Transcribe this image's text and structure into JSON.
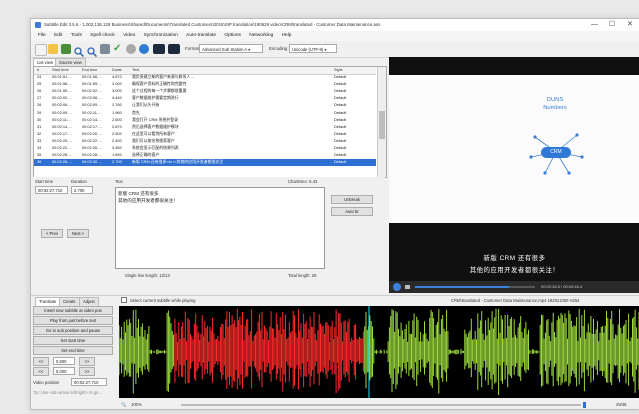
{
  "window": {
    "title": "Subtitle Edit 3.5.6 - 1.002.136.128 Business\\Shared\\Documents\\Translated Customers\\2016\\SIP translation\\180629 video\\CRM\\translated - Customer Data Maintenance.ass",
    "controls": [
      "—",
      "☐",
      "✕"
    ]
  },
  "menu": [
    "File",
    "Edit",
    "Tools",
    "Spell check",
    "Video",
    "Synchronization",
    "Auto-translate",
    "Options",
    "Networking",
    "Help"
  ],
  "toolbar": {
    "format_label": "Format",
    "format_value": "Advanced Sub Station A ▾",
    "encoding_label": "Encoding",
    "encoding_value": "Unicode (UTF-8) ▾",
    "icons": [
      "new-file-icon",
      "open-folder-icon",
      "save-icon",
      "find-icon",
      "replace-icon",
      "visual-sync-icon",
      "spell-check-icon",
      "settings-icon",
      "help-icon",
      "layout-icon",
      "video-icon"
    ]
  },
  "tabs": {
    "list_view": "List view",
    "source_view": "Source view"
  },
  "grid": {
    "headers": [
      "#",
      "Start time",
      "End time",
      "Durat.",
      "Text",
      "Style"
    ],
    "rows": [
      [
        "24",
        "00:01:51.…",
        "00:01:56.…",
        "4.870",
        "我负责建立新的客户来源与联系人…",
        "Default"
      ],
      [
        "25",
        "00:01:56.…",
        "00:01:59.…",
        "3.000",
        "确保客户资料的正确性和完整性",
        "Default"
      ],
      [
        "26",
        "00:01:59.…",
        "00:02:02.…",
        "3.000",
        "这个过程的每一个步骤都很重要",
        "Default"
      ],
      [
        "27",
        "00:02:02.…",
        "00:02:06.…",
        "4.440",
        "客户数据维护需要定期进行",
        "Default"
      ],
      [
        "28",
        "00:02:06.…",
        "00:02:09.…",
        "2.760",
        "让我们从头开始",
        "Default"
      ],
      [
        "29",
        "00:02:09.…",
        "00:02:11.…",
        "1.960",
        "首先",
        "Default"
      ],
      [
        "30",
        "00:02:11.…",
        "00:02:14.…",
        "2.600",
        "我会打开 CRM 系统并登录",
        "Default"
      ],
      [
        "31",
        "00:02:14.…",
        "00:02:17.…",
        "2.870",
        "然后选择客户数据维护模块",
        "Default"
      ],
      [
        "32",
        "00:02:17.…",
        "00:02:20.…",
        "2.500",
        "在这里可以看到所有客户",
        "Default"
      ],
      [
        "33",
        "00:02:20.…",
        "00:02:22.…",
        "2.400",
        "我们可以按名称搜索客户",
        "Default"
      ],
      [
        "34",
        "00:02:22.…",
        "00:02:26.…",
        "3.450",
        "系统会显示匹配的结果列表",
        "Default"
      ],
      [
        "35",
        "00:02:26.…",
        "00:02:28.…",
        "1.890",
        "选择正确的客户",
        "Default"
      ],
      [
        "36",
        "00:02:28.…",
        "00:02:30.…",
        "2.700",
        "新版 CRM 还有很多<br />其他的应用开发者都很关注",
        "Default"
      ]
    ],
    "selected_index": 12
  },
  "editor": {
    "start_label": "Start time",
    "duration_label": "Duration",
    "start_value": "00:02:27.710",
    "duration_value": "2.700",
    "text_label": "Text",
    "chars_label": "Chars/sec: 6.43",
    "text_line1": "新版 CRM 还有很多",
    "text_line2": "其他的应用开发者都很关注！",
    "unbreak": "Unbreak",
    "auto_br": "Auto br",
    "prev": "< Prev",
    "next": "Next >",
    "single_line": "Single line length: 13/13",
    "total_length": "Total length: 26"
  },
  "video": {
    "slide_title_1": "DUNS",
    "slide_title_2": "Numbers",
    "crm_label": "CRM",
    "subtitle_1": "新版 CRM 还有很多",
    "subtitle_2": "其他的应用开发者都很关注！",
    "time": "00:02:28.5 / 00:03:46.4"
  },
  "wavebar": {
    "tab_translate": "Translate",
    "tab_create": "Create",
    "tab_adjust": "Adjust",
    "select_current": "Select current subtitle while playing",
    "file_name": "CRM\\translated - Customer Data Maintenance.mp4 1920x1080 H264",
    "btn_insert": "Insert new subtitle at video pos",
    "btn_play": "Play from just before text",
    "btn_goto": "Go to sub position and pause",
    "btn_set_start": "Set start time",
    "btn_set_end": "Set end time",
    "btn_minus": "<<",
    "btn_plus": ">>",
    "step1": "0.500",
    "step2": "5.000",
    "video_position_label": "Video position",
    "video_position": "00:02:27.710",
    "tip": "Tip: Use <alt+arrow left/right> to go…",
    "zoom": "100%",
    "status_right": "29/48"
  },
  "colors": {
    "accent": "#2d6fd2",
    "wave_green": "#9edb3f",
    "wave_red": "#ff2b2b",
    "wave_bg": "#000000"
  }
}
